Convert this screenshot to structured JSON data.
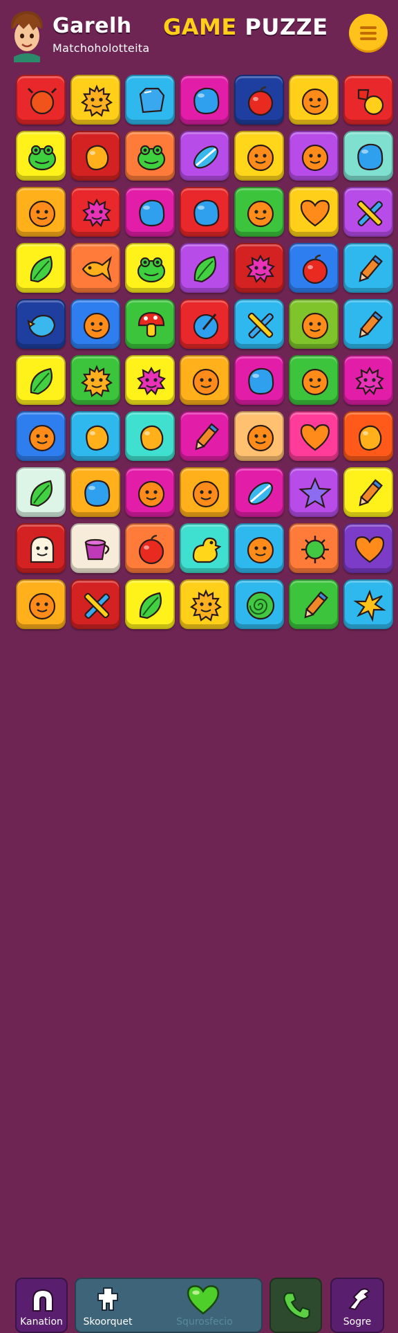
{
  "header": {
    "player_name": "Garelh",
    "player_subtitle": "Matchoholotteita",
    "title_part1": "GAME",
    "title_part2": "PUZZE",
    "menu_icon": "hamburger-menu-icon",
    "avatar_icon": "player-avatar"
  },
  "board": {
    "columns": 7,
    "rows": 10,
    "tiles": [
      [
        {
          "bg": "#e8282a",
          "icon": "crab"
        },
        {
          "bg": "#ffcf1a",
          "icon": "sun"
        },
        {
          "bg": "#2fb8ee",
          "icon": "gem"
        },
        {
          "bg": "#e21ea8",
          "icon": "blob"
        },
        {
          "bg": "#1e3fa0",
          "icon": "apple"
        },
        {
          "bg": "#ffcf1a",
          "icon": "face"
        },
        {
          "bg": "#e8282a",
          "icon": "candy"
        }
      ],
      [
        {
          "bg": "#fff21a",
          "icon": "frog"
        },
        {
          "bg": "#d42222",
          "icon": "fruit"
        },
        {
          "bg": "#ff7b3a",
          "icon": "frog"
        },
        {
          "bg": "#b74ce8",
          "icon": "candy-swirl"
        },
        {
          "bg": "#ffd61a",
          "icon": "face"
        },
        {
          "bg": "#b74ce8",
          "icon": "face"
        },
        {
          "bg": "#7fe0d0",
          "icon": "blob"
        }
      ],
      [
        {
          "bg": "#ffb01a",
          "icon": "face"
        },
        {
          "bg": "#e8282a",
          "icon": "star-blob"
        },
        {
          "bg": "#e21ea8",
          "icon": "blob"
        },
        {
          "bg": "#e8282a",
          "icon": "blob"
        },
        {
          "bg": "#3cc43c",
          "icon": "face"
        },
        {
          "bg": "#ffcf1a",
          "icon": "heart"
        },
        {
          "bg": "#b74ce8",
          "icon": "cross"
        }
      ],
      [
        {
          "bg": "#fff21a",
          "icon": "leaf"
        },
        {
          "bg": "#ff7b3a",
          "icon": "fish"
        },
        {
          "bg": "#fff21a",
          "icon": "frog"
        },
        {
          "bg": "#b74ce8",
          "icon": "leaf"
        },
        {
          "bg": "#d42222",
          "icon": "star-blob"
        },
        {
          "bg": "#2f7ef0",
          "icon": "apple"
        },
        {
          "bg": "#2fb8ee",
          "icon": "pencil"
        }
      ],
      [
        {
          "bg": "#1e3fa0",
          "icon": "bird"
        },
        {
          "bg": "#2f7ef0",
          "icon": "face"
        },
        {
          "bg": "#3cc43c",
          "icon": "mushroom"
        },
        {
          "bg": "#e8282a",
          "icon": "orb"
        },
        {
          "bg": "#2fb8ee",
          "icon": "cross"
        },
        {
          "bg": "#7ec42a",
          "icon": "face"
        },
        {
          "bg": "#2fb8ee",
          "icon": "pencil"
        }
      ],
      [
        {
          "bg": "#fff21a",
          "icon": "leaf"
        },
        {
          "bg": "#3cc43c",
          "icon": "sun"
        },
        {
          "bg": "#fff21a",
          "icon": "star-blob"
        },
        {
          "bg": "#ffb01a",
          "icon": "face"
        },
        {
          "bg": "#e21ea8",
          "icon": "blob"
        },
        {
          "bg": "#3cc43c",
          "icon": "face"
        },
        {
          "bg": "#e21ea8",
          "icon": "star-blob"
        }
      ],
      [
        {
          "bg": "#2f7ef0",
          "icon": "face"
        },
        {
          "bg": "#2fb8ee",
          "icon": "fruit"
        },
        {
          "bg": "#3fe0cf",
          "icon": "fruit"
        },
        {
          "bg": "#e21ea8",
          "icon": "pencil"
        },
        {
          "bg": "#ffc070",
          "icon": "face"
        },
        {
          "bg": "#ff3c9a",
          "icon": "heart"
        },
        {
          "bg": "#ff5a1a",
          "icon": "fruit"
        }
      ],
      [
        {
          "bg": "#dcf5e6",
          "icon": "leaf"
        },
        {
          "bg": "#ffb01a",
          "icon": "blob"
        },
        {
          "bg": "#e21ea8",
          "icon": "face"
        },
        {
          "bg": "#ffb01a",
          "icon": "face"
        },
        {
          "bg": "#e21ea8",
          "icon": "candy-swirl"
        },
        {
          "bg": "#b74ce8",
          "icon": "star"
        },
        {
          "bg": "#fff21a",
          "icon": "pencil"
        }
      ],
      [
        {
          "bg": "#d42222",
          "icon": "ghost"
        },
        {
          "bg": "#f7ecd9",
          "icon": "cup"
        },
        {
          "bg": "#ff7b3a",
          "icon": "apple"
        },
        {
          "bg": "#3fe0cf",
          "icon": "duck"
        },
        {
          "bg": "#2fb8ee",
          "icon": "face"
        },
        {
          "bg": "#ff7b3a",
          "icon": "virus"
        },
        {
          "bg": "#7c3cc8",
          "icon": "heart"
        }
      ],
      [
        {
          "bg": "#ffb01a",
          "icon": "face"
        },
        {
          "bg": "#d42222",
          "icon": "cross"
        },
        {
          "bg": "#fff21a",
          "icon": "leaf"
        },
        {
          "bg": "#ffcf1a",
          "icon": "sun"
        },
        {
          "bg": "#2fb8ee",
          "icon": "swirl"
        },
        {
          "bg": "#3cc43c",
          "icon": "pencil"
        },
        {
          "bg": "#2fb8ee",
          "icon": "star-burst"
        }
      ]
    ],
    "icon_colors": {
      "crab": "#f0541a",
      "sun": "#ffb020",
      "gem": "#3aa8ee",
      "blob": "#2fa0ee",
      "apple": "#e82a20",
      "face": "#ff8c1a",
      "candy": "#ffcf1a",
      "frog": "#3ed03e",
      "fruit": "#ffb01a",
      "candy-swirl": "#3ab8ee",
      "star-blob": "#e832b8",
      "heart": "#ff8c1a",
      "cross": "#3aa8ee",
      "leaf": "#43d043",
      "fish": "#ffb01a",
      "pencil": "#f0882a",
      "bird": "#3ab8ee",
      "mushroom": "#e82a20",
      "orb": "#2fa0ee",
      "star": "#8c6cf0",
      "ghost": "#fff4e0",
      "cup": "#c03ab8",
      "duck": "#ffd61a",
      "virus": "#43c843",
      "swirl": "#43c843",
      "star-burst": "#ffc21a"
    }
  },
  "bottom_nav": {
    "left_label": "Kanation",
    "left_icon": "magnet-icon",
    "center_left_label": "Skoorquet",
    "center_left_icon": "puzzle-piece-icon",
    "center_right_label": "Squrosfecio",
    "center_right_icon": "heart-icon",
    "phone_icon": "phone-icon",
    "right_label": "Sogre",
    "right_icon": "bird-icon"
  }
}
